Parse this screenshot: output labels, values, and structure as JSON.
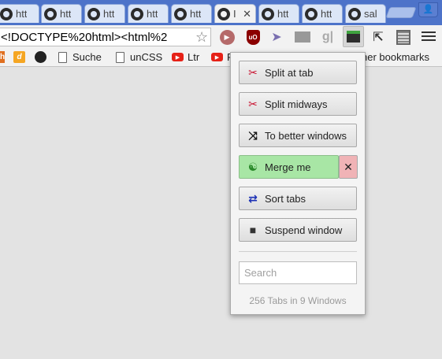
{
  "tabs": [
    {
      "label": "htt",
      "active": false
    },
    {
      "label": "htt",
      "active": false
    },
    {
      "label": "htt",
      "active": false
    },
    {
      "label": "htt",
      "active": false
    },
    {
      "label": "htt",
      "active": false
    },
    {
      "label": "I",
      "active": true,
      "close": "✕"
    },
    {
      "label": "htt",
      "active": false
    },
    {
      "label": "htt",
      "active": false
    },
    {
      "label": "sal",
      "active": false
    }
  ],
  "address_bar": {
    "url": "<!DOCTYPE%20html><html%2",
    "star": "☆"
  },
  "bookmarks": [
    {
      "label": "h"
    },
    {
      "label": ""
    },
    {
      "label": ""
    },
    {
      "label": "Suche"
    },
    {
      "label": "unCSS"
    },
    {
      "label": "Ltr"
    },
    {
      "label": "F"
    },
    {
      "label": "her bookmarks"
    }
  ],
  "popup": {
    "buttons": [
      {
        "label": "Split at tab",
        "icon": "✂"
      },
      {
        "label": "Split midways",
        "icon": "✂"
      },
      {
        "label": "To better windows",
        "icon": "⤨"
      },
      {
        "label": "Merge me",
        "icon": "☯"
      },
      {
        "label": "Sort tabs",
        "icon": "⇄"
      },
      {
        "label": "Suspend window",
        "icon": "■"
      }
    ],
    "merge_close": "✕",
    "search_placeholder": "Search",
    "stats": "256 Tabs in 9 Windows"
  },
  "colors": {
    "tabstrip": "#4d73c9",
    "merge_button": "#a8e6a5",
    "merge_close": "#f0b3b6",
    "scissors": "#c8102e",
    "sort_icon": "#1a2fb5"
  }
}
